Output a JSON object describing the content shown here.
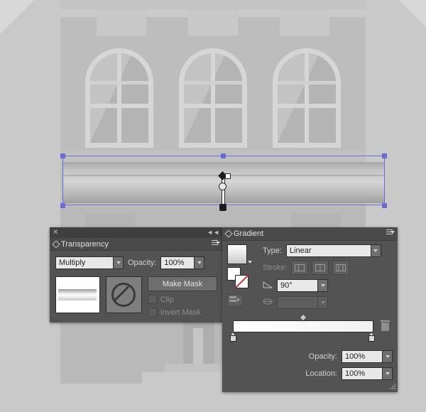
{
  "app": {
    "artwork_description": "Grayscale building illustration with three arched windows and a selected gradient-filled band"
  },
  "selection": {
    "gradient_annotator": "gradient-annotator-handle"
  },
  "transparency_panel": {
    "close_icon": "✕",
    "collapse_icon": "◄◄",
    "menu_icon": "panel-menu",
    "title": "Transparency",
    "blend_mode": "Multiply",
    "opacity_label": "Opacity:",
    "opacity_value": "100%",
    "make_mask_button": "Make Mask",
    "clip_label": "Clip",
    "invert_mask_label": "Invert Mask"
  },
  "gradient_panel": {
    "title": "Gradient",
    "menu_icon": "panel-menu",
    "type_label": "Type:",
    "type_value": "Linear",
    "stroke_label": "Stroke:",
    "angle_label": "angle-icon",
    "angle_value": "90°",
    "aspect_label": "aspect-ratio-icon",
    "aspect_value": "",
    "reverse_label": "reverse-gradient-icon",
    "opacity_label": "Opacity:",
    "opacity_value": "100%",
    "location_label": "Location:",
    "location_value": "100%",
    "delete_stop_icon": "trash-icon",
    "stops": [
      {
        "position": "0%",
        "color": "#ffffff"
      },
      {
        "position": "100%",
        "color": "#f2f2f2"
      }
    ],
    "midpoint": "50%"
  }
}
